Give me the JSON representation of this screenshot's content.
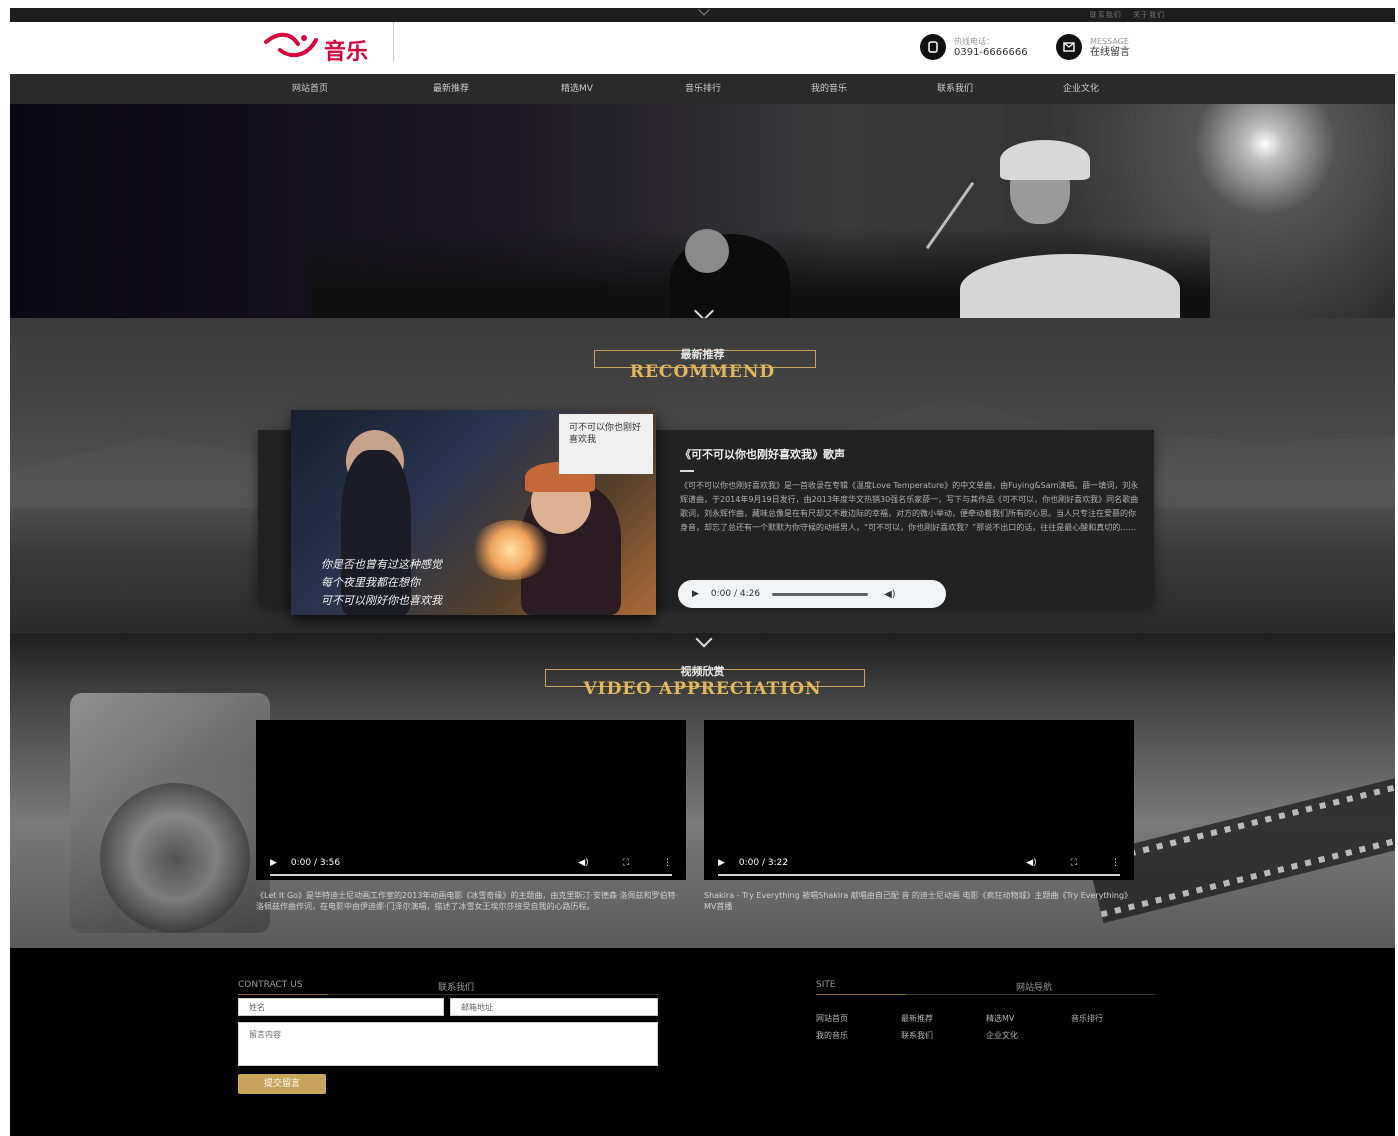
{
  "topbar": {
    "links": [
      "联系我们",
      "关于我们"
    ]
  },
  "header": {
    "logo_text": "音乐",
    "phone_label": "热线电话：",
    "phone_number": "0391-6666666",
    "message_label": "MESSAGE",
    "message_text": "在线留言"
  },
  "nav": {
    "items": [
      "网站首页",
      "最新推荐",
      "精选MV",
      "音乐排行",
      "我的音乐",
      "联系我们",
      "企业文化"
    ]
  },
  "recommend": {
    "title_cn": "最新推荐",
    "title_en": "RECOMMEND",
    "album_card": "可不可以你也刚好喜欢我",
    "album_lyrics": [
      "你是否也曾有过这种感觉",
      "每个夜里我都在想你",
      "可不可以刚好你也喜欢我"
    ],
    "song_title": "《可不可以你也刚好喜欢我》歌声",
    "song_desc": "《可不可以你也刚好喜欢我》是一首收录在专辑《温度Love Temperature》的中文单曲，由Fuying&Sam演唱。薛一填词，刘永辉谱曲，于2014年9月19日发行，由2013年度华文热销30强名乐家薛一，写下与其作品《可不可以，你也刚好喜欢我》同名歌曲歌词，刘永辉作曲，藏味总像是在有尺却又不敢边际的幸福，对方的微小举动，便牵动着我们所有的心思。当人只专注在爱慕的你身音，却忘了总还有一个默默为你守候的动摇男人，“可不可以，你也刚好喜欢我？”那说不出口的话，往往是最心酸和真切的……",
    "audio_time": "0:00 / 4:26"
  },
  "video": {
    "title_cn": "视频欣赏",
    "title_en": "VIDEO APPRECIATION",
    "players": [
      {
        "time": "0:00 / 3:56",
        "caption": "《Let It Go》是华特迪士尼动画工作室的2013年动画电影《冰雪奇缘》的主题曲，由克里斯汀·安德森·洛佩兹和罗伯特·洛佩兹作曲作词，在电影中由伊迪娜·门泽尔演唱，描述了冰雪女王埃尔莎接受自我的心路历程。"
      },
      {
        "time": "0:00 / 3:22",
        "caption": "Shakira - Try Everything 被唱Shakira 献唱由自己配 音 的迪士尼动画 电影《疯狂动物城》主题曲《Try Everything》MV首播"
      }
    ]
  },
  "footer": {
    "contact_en": "CONTRACT US",
    "contact_cn": "联系我们",
    "name_placeholder": "姓名",
    "email_placeholder": "邮箱地址",
    "message_placeholder": "留言内容",
    "submit": "提交留言",
    "site_en": "SITE",
    "site_cn": "网站导航",
    "site_links": [
      "网站首页",
      "最新推荐",
      "精选MV",
      "音乐排行",
      "我的音乐",
      "联系我们",
      "企业文化"
    ]
  },
  "colors": {
    "accent": "#c9a45c",
    "logo": "#d6003a"
  }
}
